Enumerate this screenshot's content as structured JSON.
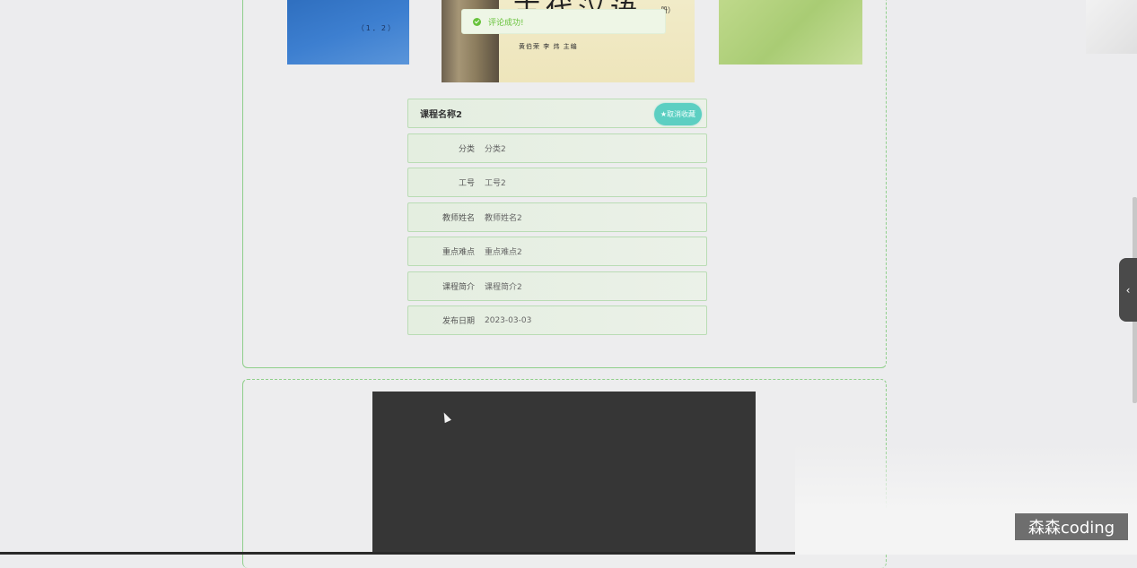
{
  "toast": {
    "message": "评论成功!"
  },
  "gallery": {
    "left_volume": "（1．2）",
    "center_title": "古代汉语",
    "center_authors": "黄伯荣  李  炜  主编",
    "center_paren": "册）"
  },
  "course": {
    "title": "课程名称2",
    "unfavorite_label": "★取消收藏",
    "fields": [
      {
        "label": "分类",
        "value": "分类2"
      },
      {
        "label": "工号",
        "value": "工号2"
      },
      {
        "label": "教师姓名",
        "value": "教师姓名2"
      },
      {
        "label": "重点难点",
        "value": "重点难点2"
      },
      {
        "label": "课程简介",
        "value": "课程简介2"
      },
      {
        "label": "发布日期",
        "value": "2023-03-03"
      }
    ]
  },
  "side_toggle": {
    "icon": "chevron-left-icon",
    "glyph": "‹"
  },
  "watermark": "森森coding",
  "colors": {
    "accent": "#5ccfc2",
    "success": "#67c23a",
    "border": "#8fcf8a"
  }
}
